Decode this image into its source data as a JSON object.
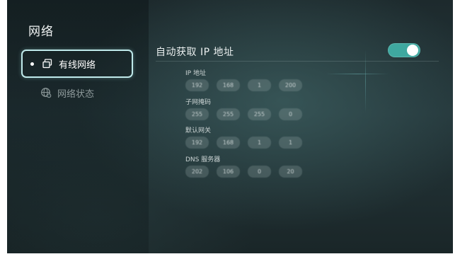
{
  "header": {
    "title": "网络"
  },
  "sidebar": {
    "items": [
      {
        "label": "有线网络",
        "icon": "wired-network-icon",
        "active": true
      },
      {
        "label": "网络状态",
        "icon": "globe-icon",
        "active": false
      }
    ]
  },
  "main": {
    "auto_ip": {
      "label": "自动获取 IP 地址",
      "enabled": true
    },
    "fields": [
      {
        "label": "IP 地址",
        "octets": [
          "192",
          "168",
          "1",
          "200"
        ]
      },
      {
        "label": "子网掩码",
        "octets": [
          "255",
          "255",
          "255",
          "0"
        ]
      },
      {
        "label": "默认网关",
        "octets": [
          "192",
          "168",
          "1",
          "1"
        ]
      },
      {
        "label": "DNS 服务器",
        "octets": [
          "202",
          "106",
          "0",
          "20"
        ]
      }
    ]
  },
  "colors": {
    "accent": "#3fa8a0",
    "focus_border": "#bfe9ea"
  }
}
